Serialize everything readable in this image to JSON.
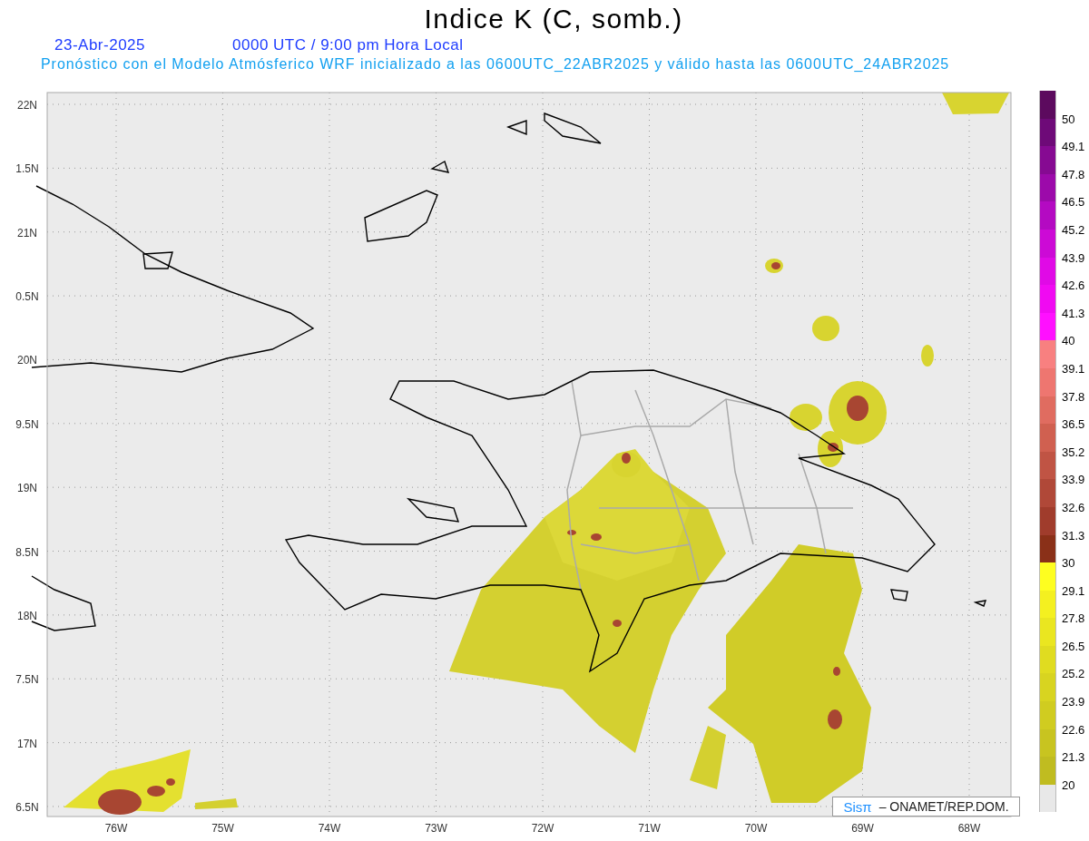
{
  "title": "Indice K (C, somb.)",
  "date": "23-Abr-2025",
  "time_label": "0000 UTC / 9:00 pm Hora Local",
  "subtitle": "Pronóstico con el Modelo Atmósferico WRF inicializado a las 0600UTC_22ABR2025 y válido hasta las  0600UTC_24ABR2025",
  "map": {
    "y_ticks": [
      "22N",
      "1.5N",
      "21N",
      "0.5N",
      "20N",
      "9.5N",
      "19N",
      "8.5N",
      "18N",
      "7.5N",
      "17N",
      "6.5N"
    ],
    "x_ticks": [
      "76W",
      "75W",
      "74W",
      "73W",
      "72W",
      "71W",
      "70W",
      "69W",
      "68W"
    ],
    "credit": {
      "brand": "Sisπ",
      "text": "– ONAMET/REP.DOM."
    }
  },
  "colorbar": {
    "segments": [
      {
        "color": "#5c0a5e",
        "label": "50"
      },
      {
        "color": "#6e0a78",
        "label": "49.1"
      },
      {
        "color": "#860a92",
        "label": "47.8"
      },
      {
        "color": "#9c0aaa",
        "label": "46.5"
      },
      {
        "color": "#b40ac2",
        "label": "45.2"
      },
      {
        "color": "#cc0ad6",
        "label": "43.9"
      },
      {
        "color": "#e00ae6",
        "label": "42.6"
      },
      {
        "color": "#f00af2",
        "label": "41.3"
      },
      {
        "color": "#ff10ff",
        "label": "40"
      },
      {
        "color": "#f88080",
        "label": "39.1"
      },
      {
        "color": "#ee7670",
        "label": "37.8"
      },
      {
        "color": "#e06c60",
        "label": "36.5"
      },
      {
        "color": "#d06050",
        "label": "35.2"
      },
      {
        "color": "#c05444",
        "label": "33.9"
      },
      {
        "color": "#b04838",
        "label": "32.6"
      },
      {
        "color": "#a03c2c",
        "label": "31.3"
      },
      {
        "color": "#8a3018",
        "label": "30"
      },
      {
        "color": "#fefe20",
        "label": "29.1"
      },
      {
        "color": "#f4f020",
        "label": "27.8"
      },
      {
        "color": "#eae620",
        "label": "26.5"
      },
      {
        "color": "#e0dc20",
        "label": "25.2"
      },
      {
        "color": "#d8d420",
        "label": "23.9"
      },
      {
        "color": "#d0cc20",
        "label": "22.6"
      },
      {
        "color": "#c8c420",
        "label": "21.3"
      },
      {
        "color": "#c0bc20",
        "label": "20"
      },
      {
        "color": "#e8e8e8"
      }
    ]
  }
}
